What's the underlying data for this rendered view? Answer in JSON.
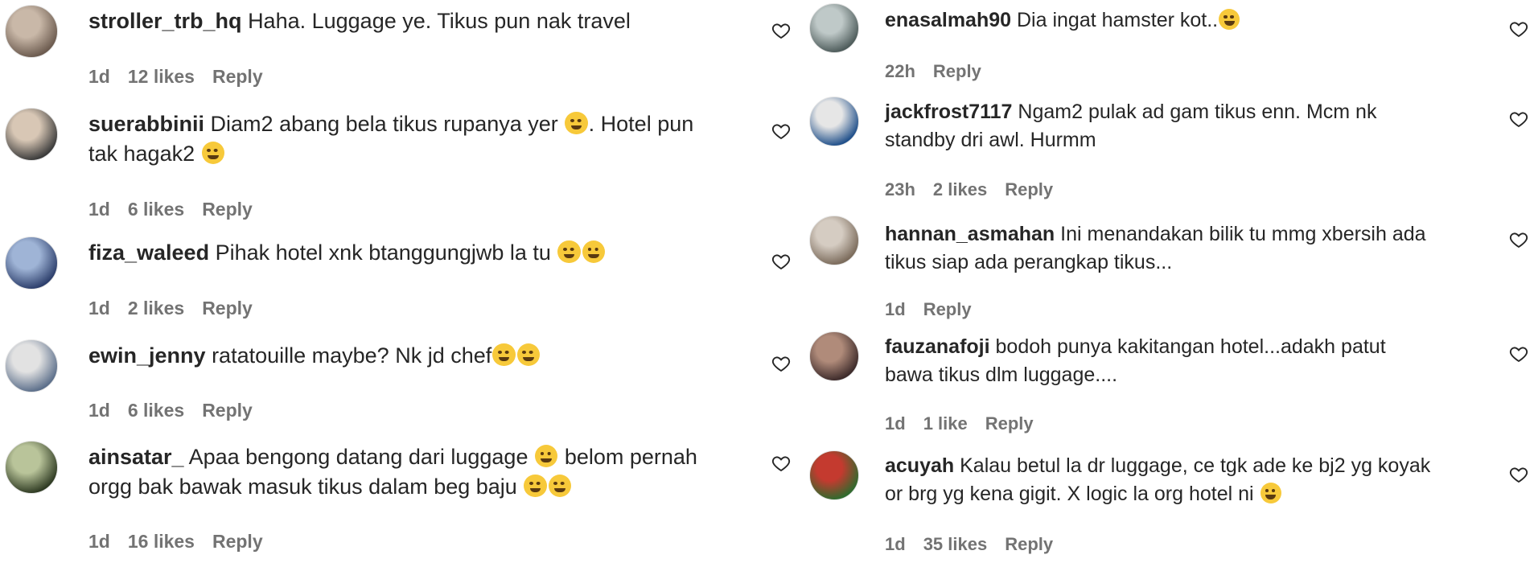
{
  "left_comments": [
    {
      "username": "stroller_trb_hq",
      "text": "Haha. Luggage ye. Tikus pun nak travel",
      "emojis": [],
      "time": "1d",
      "likes": "12 likes",
      "reply": "Reply"
    },
    {
      "username": "suerabbinii",
      "text": "Diam2 abang bela tikus rupanya yer ",
      "emojis": [
        "rofl"
      ],
      "text2": ". Hotel pun tak hagak2 ",
      "emojis2": [
        "grin"
      ],
      "time": "1d",
      "likes": "6 likes",
      "reply": "Reply"
    },
    {
      "username": "fiza_waleed",
      "text": "Pihak hotel xnk btanggungjwb la tu ",
      "emojis": [
        "joy",
        "joy"
      ],
      "time": "1d",
      "likes": "2 likes",
      "reply": "Reply"
    },
    {
      "username": "ewin_jenny",
      "text": "ratatouille maybe? Nk jd chef",
      "emojis": [
        "sweat-smile",
        "joy"
      ],
      "time": "1d",
      "likes": "6 likes",
      "reply": "Reply"
    },
    {
      "username": "ainsatar_",
      "text": "Apaa bengong datang dari luggage ",
      "emojis": [
        "rofl"
      ],
      "text2": " belom pernah orgg bak bawak masuk tikus dalam beg baju ",
      "emojis2": [
        "rofl",
        "rofl"
      ],
      "time": "1d",
      "likes": "16 likes",
      "reply": "Reply"
    }
  ],
  "right_comments": [
    {
      "username": "enasalmah90",
      "text": "Dia ingat hamster kot..",
      "emojis": [
        "joy"
      ],
      "time": "22h",
      "likes": "",
      "reply": "Reply"
    },
    {
      "username": "jackfrost7117",
      "text": "Ngam2 pulak ad gam tikus enn. Mcm nk standby dri awl. Hurmm",
      "emojis": [],
      "time": "23h",
      "likes": "2 likes",
      "reply": "Reply"
    },
    {
      "username": "hannan_asmahan",
      "text": "Ini menandakan bilik tu mmg xbersih ada tikus siap ada perangkap tikus...",
      "emojis": [],
      "time": "1d",
      "likes": "",
      "reply": "Reply"
    },
    {
      "username": "fauzanafoji",
      "text": "bodoh punya kakitangan hotel...adakh patut bawa tikus dlm luggage....",
      "emojis": [],
      "time": "1d",
      "likes": "1 like",
      "reply": "Reply"
    },
    {
      "username": "acuyah",
      "text": "Kalau betul la dr luggage, ce tgk ade ke bj2 yg koyak or brg yg kena gigit. X logic la org hotel ni ",
      "emojis": [
        "unamused"
      ],
      "time": "1d",
      "likes": "35 likes",
      "reply": "Reply"
    }
  ],
  "icons": {
    "like": "heart-outline-icon"
  },
  "colors": {
    "text": "#262626",
    "meta": "#737373",
    "background": "#ffffff"
  }
}
